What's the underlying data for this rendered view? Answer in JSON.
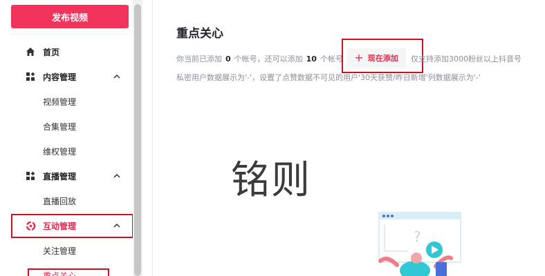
{
  "sidebar": {
    "publish_label": "发布视频",
    "items": [
      {
        "label": "首页",
        "icon": "home-icon"
      },
      {
        "label": "内容管理",
        "icon": "grid-icon"
      },
      {
        "label": "视频管理"
      },
      {
        "label": "合集管理"
      },
      {
        "label": "维权管理"
      },
      {
        "label": "直播管理",
        "icon": "grid-icon"
      },
      {
        "label": "直播回放"
      },
      {
        "label": "互动管理",
        "icon": "interaction-icon"
      },
      {
        "label": "关注管理"
      },
      {
        "label": "重点关心"
      }
    ]
  },
  "main": {
    "title": "重点关心",
    "info": {
      "prefix": "你当前已添加",
      "added_count": "0",
      "mid": "个帐号，还可以添加",
      "remaining_count": "10",
      "suffix": "个帐号",
      "after_button": "仅支持添加3000粉丝以上抖音号",
      "line2": "私密用户数据展示为'-'，设置了点赞数据不可见的用户'30天获赞/昨日新增'列数据展示为'-'"
    },
    "add_button_label": "现在添加"
  },
  "watermark": "铭则",
  "colors": {
    "accent": "#f2335b",
    "highlight_box": "#c9121b"
  }
}
